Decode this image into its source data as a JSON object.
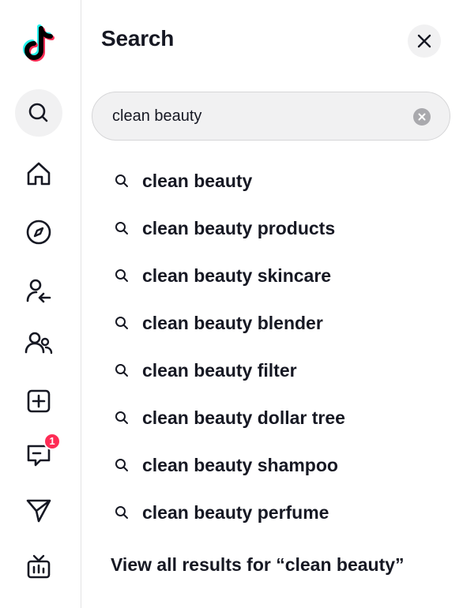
{
  "panel": {
    "title": "Search",
    "close_icon": "close-icon"
  },
  "search": {
    "value": "clean beauty",
    "clear_icon": "clear-icon"
  },
  "suggestions": [
    "clean beauty",
    "clean beauty products",
    "clean beauty skincare",
    "clean beauty blender",
    "clean beauty filter",
    "clean beauty dollar tree",
    "clean beauty shampoo",
    "clean beauty perfume"
  ],
  "view_all": "View all results for “clean beauty”",
  "nav": {
    "logo": "tiktok-logo",
    "items": [
      {
        "icon": "search-icon",
        "active": true
      },
      {
        "icon": "home-icon"
      },
      {
        "icon": "explore-icon"
      },
      {
        "icon": "following-icon"
      },
      {
        "icon": "friends-icon"
      },
      {
        "icon": "upload-icon"
      },
      {
        "icon": "inbox-icon",
        "badge": "1"
      },
      {
        "icon": "messages-icon"
      },
      {
        "icon": "live-icon"
      }
    ]
  },
  "colors": {
    "accent": "#fe2c55",
    "cyan": "#25f4ee",
    "text": "#161823",
    "pill": "#f1f1f2"
  }
}
